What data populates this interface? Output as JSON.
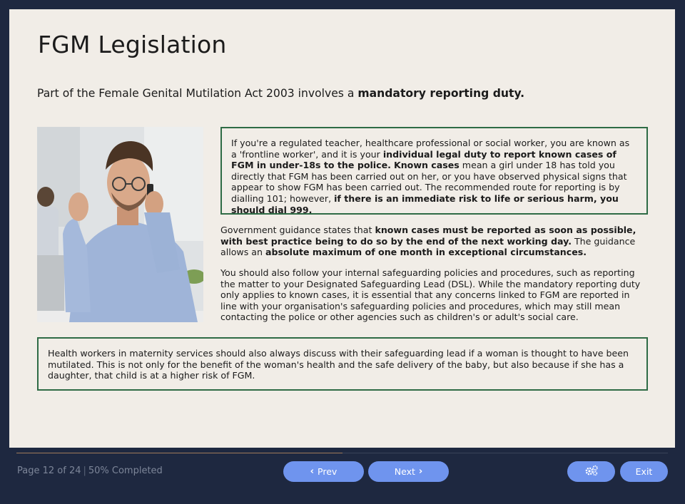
{
  "slide": {
    "title": "FGM Legislation",
    "intro_plain": "Part of the Female Genital Mutilation Act 2003 involves a ",
    "intro_bold": "mandatory reporting duty.",
    "box1": {
      "t1": "If you're a regulated teacher, healthcare professional or social worker, you are known as a 'frontline worker', and it is your ",
      "b1": "individual legal duty to report known cases of FGM in under-18s to the police.",
      "t2": " ",
      "b2": "Known cases",
      "t3": " mean a girl under 18 has told you directly that FGM has been carried out on her, or you have observed physical signs that appear to show FGM has been carried out. The recommended route for reporting is by dialling 101; however, ",
      "b3": "if there is an immediate risk to life or serious harm, you should dial 999."
    },
    "para1": {
      "t1": "Government guidance states that ",
      "b1": "known cases must be reported as soon as possible, with best practice being to do so by the end of the next working day.",
      "t2": " The guidance allows an ",
      "b2": "absolute maximum of one month in exceptional circumstances."
    },
    "para2": "You should also follow your internal safeguarding policies and procedures, such as reporting the matter to your Designated Safeguarding Lead (DSL). While the mandatory reporting duty only applies to known cases, it is essential that any concerns linked to FGM are reported in line with your organisation's safeguarding policies and procedures, which may still mean contacting the police or other agencies such as children's or adult's social care.",
    "box2": "Health workers in maternity services should also always discuss with their safeguarding lead if a woman is thought to have been mutilated. This is not only for the benefit of the woman's health and the safe delivery of the baby, but also because if she has a daughter, that child is at a higher risk of FGM."
  },
  "footer": {
    "page_label": "Page 12 of 24",
    "separator": "|",
    "completed_label": "50% Completed",
    "progress_fraction": 0.5,
    "prev_label": "Prev",
    "next_label": "Next",
    "exit_label": "Exit",
    "settings_icon": "gears-icon"
  },
  "colors": {
    "background": "#1e2840",
    "slide": "#f1ede7",
    "box_border": "#2e6b45",
    "button": "#6f94ee"
  }
}
